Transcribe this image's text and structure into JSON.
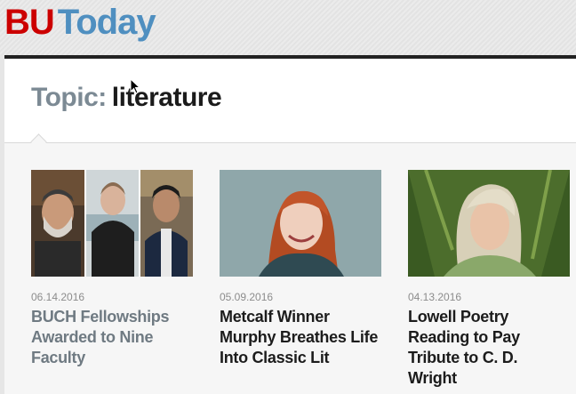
{
  "masthead": {
    "logo_part1": "BU",
    "logo_part2": "Today"
  },
  "topic": {
    "label": "Topic:",
    "value": "literature"
  },
  "articles": [
    {
      "date": "06.14.2016",
      "title": "BUCH Fellowships Awarded to Nine Faculty"
    },
    {
      "date": "05.09.2016",
      "title": "Metcalf Winner Murphy Breathes Life Into Classic Lit"
    },
    {
      "date": "04.13.2016",
      "title": "Lowell Poetry Reading to Pay Tribute to C. D. Wright"
    }
  ],
  "colors": {
    "brand_red": "#cc0000",
    "brand_blue": "#4f8fc0",
    "topic_gray": "#7c8a94"
  }
}
